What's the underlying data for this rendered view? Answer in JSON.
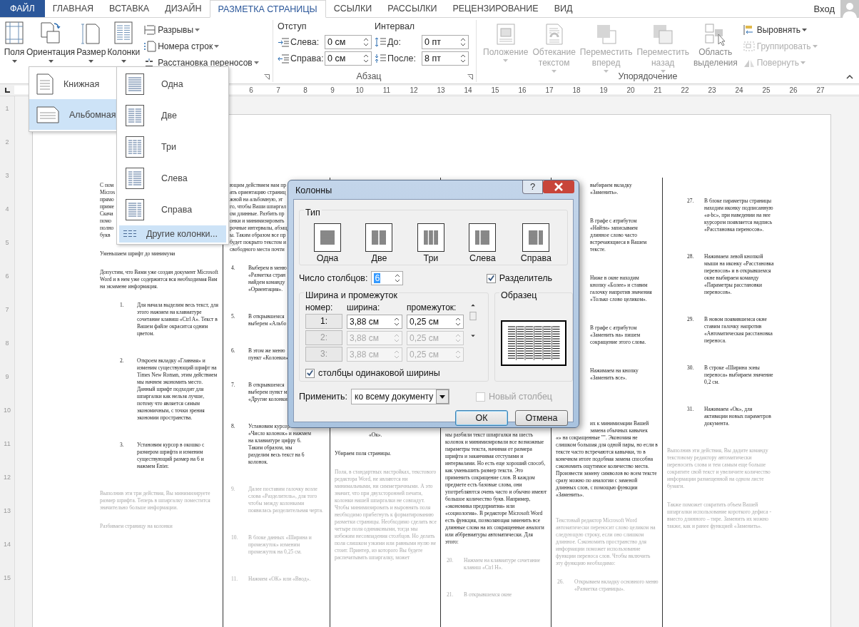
{
  "ribbon": {
    "tabs": [
      {
        "label": "ФАЙЛ",
        "kind": "file",
        "selected": false
      },
      {
        "label": "ГЛАВНАЯ",
        "kind": "tab",
        "selected": false
      },
      {
        "label": "ВСТАВКА",
        "kind": "tab",
        "selected": false
      },
      {
        "label": "ДИЗАЙН",
        "kind": "tab",
        "selected": false
      },
      {
        "label": "РАЗМЕТКА СТРАНИЦЫ",
        "kind": "tab",
        "selected": true
      },
      {
        "label": "ССЫЛКИ",
        "kind": "tab",
        "selected": false
      },
      {
        "label": "РАССЫЛКИ",
        "kind": "tab",
        "selected": false
      },
      {
        "label": "РЕЦЕНЗИРОВАНИЕ",
        "kind": "tab",
        "selected": false
      },
      {
        "label": "ВИД",
        "kind": "tab",
        "selected": false
      }
    ],
    "account": {
      "label": "Вход"
    },
    "page_setup": {
      "large_buttons": [
        {
          "label": "Поля",
          "kind": "margins"
        },
        {
          "label": "Ориентация",
          "kind": "orientation"
        },
        {
          "label": "Размер",
          "kind": "size"
        },
        {
          "label": "Колонки",
          "kind": "columns"
        }
      ],
      "small_buttons": [
        {
          "label": "Разрывы",
          "kind": "breaks"
        },
        {
          "label": "Номера строк",
          "kind": "line_numbers"
        },
        {
          "label": "Расстановка переносов",
          "kind": "hyphenation"
        }
      ]
    },
    "paragraph": {
      "title": "Абзац",
      "indent": {
        "label": "Отступ",
        "fields": [
          {
            "label": "Слева:",
            "kind": "indent_left",
            "value": "0 см"
          },
          {
            "label": "Справа:",
            "kind": "indent_right",
            "value": "0 см"
          }
        ]
      },
      "spacing": {
        "label": "Интервал",
        "fields": [
          {
            "label": "До:",
            "kind": "before",
            "value": "0 пт"
          },
          {
            "label": "После:",
            "kind": "after",
            "value": "8 пт"
          }
        ]
      }
    },
    "arrange": {
      "title": "Упорядочение",
      "large_buttons": [
        {
          "label": "Положение",
          "kind": "position",
          "disabled": true
        },
        {
          "label": "Обтекание текстом",
          "kind": "wrap",
          "disabled": true
        },
        {
          "label": "Переместить вперед",
          "kind": "forward",
          "disabled": true
        },
        {
          "label": "Переместить назад",
          "kind": "backward",
          "disabled": true
        },
        {
          "label": "Область выделения",
          "kind": "selection",
          "disabled": false
        }
      ],
      "small_buttons": [
        {
          "label": "Выровнять",
          "kind": "align",
          "disabled": false
        },
        {
          "label": "Группировать",
          "kind": "group",
          "disabled": true
        },
        {
          "label": "Повернуть",
          "kind": "rotate",
          "disabled": true
        }
      ]
    }
  },
  "ruler": {
    "numbers": [
      "6",
      "7",
      "8",
      "9",
      "10",
      "11",
      "12",
      "13",
      "14",
      "15",
      "16",
      "17",
      "18",
      "19",
      "20",
      "21",
      "22",
      "23",
      "24",
      "25",
      "26",
      "27"
    ],
    "side_numbers": [
      "1",
      "2",
      "3",
      "4",
      "5",
      "6",
      "7",
      "8",
      "9",
      "10",
      "11",
      "12",
      "13",
      "14",
      "15"
    ]
  },
  "document": {
    "columns": [
      {
        "blocks": [
          {
            "kind": "lines",
            "faded": false,
            "lines": [
              "С пом",
              "Micros",
              "прямо",
              "приме",
              "Скача",
              "помо",
              "полно",
              "букв"
            ]
          },
          {
            "kind": "para",
            "faded": false,
            "text": "Уменьшаем шрифт до минимума"
          },
          {
            "kind": "para",
            "faded": false,
            "text": "Допустим, что Вами уже создан документ Microsoft Word и в нем уже содержится вся необходимая Вам на экзамене информация."
          },
          {
            "kind": "item",
            "faded": false,
            "number": "1.",
            "text": "Для начала выделим весь текст, для этого нажмем на клавиатуре сочетание клавиш «Ctrl A». Текст в Вашем файле окрасится одним цветом."
          },
          {
            "kind": "item",
            "faded": false,
            "number": "2.",
            "text": "Откроем вкладку «Главная» и изменим существующий шрифт на Times New Roman, этим действием мы начнем экономить место. Данный шрифт подходит для шпаргалки как нельзя лучше, потому что является самым экономичным, с точки зрения экономии пространства."
          },
          {
            "kind": "item",
            "faded": false,
            "number": "3.",
            "text": "Установим курсор в окошко с размером шрифта и изменим существующий размер на 6 и нажмем Enter."
          },
          {
            "kind": "para",
            "faded": true,
            "text": "Выполнив эти три действия, Вы минимизируете размер шрифта. Теперь в шпаргалку поместится значительно больше информации."
          },
          {
            "kind": "para",
            "faded": true,
            "text": "Разбиваем страницу на колонки"
          }
        ]
      },
      {
        "blocks": [
          {
            "kind": "lines",
            "faded": false,
            "lines": [
              "ющим действием нам пр",
              "ать ориентацию страниц",
              "жной на альбомную, эт",
              "го, чтобы Ваши шпаргал",
              "ом длинные. Разбить пр",
              "онки и минимизировать",
              "рочные интервалы, абзац",
              "ы. Таким образом все пр",
              "будет покрыто текстом и",
              "свободного места почти"
            ]
          },
          {
            "kind": "item_lines",
            "faded": false,
            "number": "4.",
            "lines": [
              "Выберем в меню",
              "«Разметка стран",
              "найдем команду",
              "«Ориентация»."
            ]
          },
          {
            "kind": "item_lines",
            "faded": false,
            "number": "5.",
            "lines": [
              "В открывшемся",
              "выберем «Альбо"
            ]
          },
          {
            "kind": "item_lines",
            "faded": false,
            "number": "6.",
            "lines": [
              "В этом же меню",
              "пункт «Колонки»"
            ]
          },
          {
            "kind": "item_lines",
            "faded": false,
            "number": "7.",
            "lines": [
              "В открывшемся",
              "выберем пункт м",
              "«Другие колонки"
            ]
          },
          {
            "kind": "item_lines",
            "faded": false,
            "number": "8.",
            "lines": [
              "Установим курсор",
              "«Число колонок» и нажмем",
              "на клавиатуре цифру 6.",
              "Таким образом, мы",
              "разделим весь текст на 6",
              "колонок."
            ]
          },
          {
            "kind": "item",
            "faded": true,
            "number": "9.",
            "text": "Далее поставим галочку возле слова «Разделитель», для того чтобы между колонками появилась разделительная черта."
          },
          {
            "kind": "item",
            "faded": true,
            "number": "10.",
            "text": "В блоке данных «Ширина и промежуток» изменим промежуток на 0,25 см."
          },
          {
            "kind": "item",
            "faded": true,
            "number": "11.",
            "text": "Нажмем «ОК» или «Ввод»."
          }
        ]
      },
      {
        "blocks": [
          {
            "kind": "tail",
            "faded": false,
            "text": "«Ок»."
          },
          {
            "kind": "para",
            "faded": false,
            "text": "Убираем поля страницы."
          },
          {
            "kind": "para",
            "faded": true,
            "text": "Поля, в стандартных настройках, текстового редактора Word, не являются ни минимальными, ни симметричными. А это значит, что при двухсторонней печати, колонки нашей шпаргалки не совпадут. Чтобы минимизировать и выровнять поля необходимо прибегнуть к форматированию разметки страницы. Необходимо сделать все четыре поля одинаковыми, тогда мы избежим несовпадения столбцов. Но делать поля слишком узкими или равными нулю не стоит. Принтер, из которого Вы будете распечатывать шпаргалку, может"
          }
        ]
      },
      {
        "blocks": [
          {
            "kind": "para",
            "faded": false,
            "text": "мы разбили текст шпаргалки на шесть колонок и минимизировали все возможные параметры текста, начиная от размера шрифта и заканчивая отступами и интервалами. Но есть еще хороший способ, как уменьшить размер текста. Это применить сокращение слов. В каждом предмете есть базовые слова, они употребляются очень часто и обычно имеют большое количество букв. Например, «экономика предприятия» или «социология». В редакторе Microsoft Word есть функция, позволяющая заменить все длинные слова на их сокращенные аналоги или аббревиатуры автоматически. Для этого:"
          },
          {
            "kind": "item",
            "faded": true,
            "number": "20.",
            "text": "Нажмем на клавиатуре сочетание клавиш «Ctrl H»."
          },
          {
            "kind": "item",
            "faded": true,
            "number": "21.",
            "text": "В открывшемся окне"
          }
        ]
      },
      {
        "blocks": [
          {
            "kind": "lines",
            "faded": false,
            "lines": [
              "выбираем вкладку",
              "«Заменить»."
            ]
          },
          {
            "kind": "lines",
            "faded": false,
            "lines": [
              "В графе с атрибутом",
              "«Найти» записываем",
              "длинное слово часто",
              "встречающиеся в Вашем",
              "тексте."
            ]
          },
          {
            "kind": "lines",
            "faded": false,
            "lines": [
              "Ниже в окне находим",
              "кнопку «Более» и ставим",
              "галочку напротив значения",
              "«Только слово целиком»."
            ]
          },
          {
            "kind": "lines",
            "faded": false,
            "lines": [
              "В графе с атрибутом",
              "«Заменить на» пишем",
              "сокращение этого слова."
            ]
          },
          {
            "kind": "lines",
            "faded": false,
            "lines": [
              "Нажимаем на кнопку",
              "«Заменить все»."
            ]
          },
          {
            "kind": "lines",
            "faded": false,
            "lines": [
              "их к минимизации Вашей",
              "замена обычных кавычек"
            ]
          },
          {
            "kind": "para",
            "faded": false,
            "text": "«» на сокращенные \"\". Экономия не слишком большая для одной пары, но если в тексте часто встречаются кавычки, то в конечном итоге подобная замена способна сэкономить ощутимое количество места. Произвести замену символов во всем тексте сразу можно по аналогии с заменой длинных слов, с помощью функции «Заменить»."
          },
          {
            "kind": "para",
            "faded": true,
            "text": "Текстовый редактор Microsoft Word автоматически переносит слово целиком на следующую строку, если оно слишком длинное. Сэкономить пространство для информации поможет использование функции переноса слов. Чтобы включить эту функцию необходимо:"
          },
          {
            "kind": "item",
            "faded": true,
            "number": "26.",
            "text": "Открываем вкладку основного меню «Разметка страницы»."
          }
        ]
      },
      {
        "blocks": [
          {
            "kind": "item",
            "faded": false,
            "number": "27.",
            "text": "В блоке параметры страницы находим иконку подписанную «a-bc», при наведении на нее курсором появляется надпись «Расстановка переносов»."
          },
          {
            "kind": "item",
            "faded": false,
            "number": "28.",
            "text": "Нажимаем левой кнопкой мыши на иконку «Расстановка переносов» и в открывшемся окне выбираем команду «Параметры расстановки переносов»."
          },
          {
            "kind": "item",
            "faded": false,
            "number": "29.",
            "text": "В новом появившемся окне ставим галочку напротив «Автоматическая расстановка переноса."
          },
          {
            "kind": "item",
            "faded": false,
            "number": "30.",
            "text": "В строке «Ширина зоны переноса» выбираем значение 0,2 см."
          },
          {
            "kind": "item",
            "faded": false,
            "number": "31.",
            "text": "Нажимаем «Ок», для активации новых параметров документа."
          },
          {
            "kind": "para",
            "faded": true,
            "text": "Выполнив эти действия, Вы дадите команду текстовому редактору автоматически переносить слова и тем самым еще больше сократите свой текст и увеличите количество информации размещенной на одном листе бумаги."
          },
          {
            "kind": "para",
            "faded": true,
            "text": "Также поможет сократить объем Вашей шпаргалки использование короткого дефиса - вместо длинного – тире. Заменить их можно также, как и ранее функцией «Заменить»."
          }
        ]
      }
    ]
  },
  "orientation_menu": {
    "items": [
      {
        "label": "Книжная",
        "kind": "portrait",
        "selected": false
      },
      {
        "label": "Альбомная",
        "kind": "landscape",
        "selected": true
      }
    ]
  },
  "columns_menu": {
    "items": [
      {
        "label": "Одна",
        "kind": "one",
        "selected": false
      },
      {
        "label": "Две",
        "kind": "two",
        "selected": false
      },
      {
        "label": "Три",
        "kind": "three",
        "selected": false
      },
      {
        "label": "Слева",
        "kind": "left",
        "selected": false
      },
      {
        "label": "Справа",
        "kind": "right",
        "selected": false
      },
      {
        "label": "Другие колонки...",
        "kind": "more",
        "selected": true
      }
    ]
  },
  "dialog": {
    "title": "Колонны",
    "help_label": "?",
    "type_group": {
      "title": "Тип",
      "presets": [
        {
          "label": "Одна",
          "kind": "one",
          "selected": false
        },
        {
          "label": "Две",
          "kind": "two",
          "selected": false
        },
        {
          "label": "Три",
          "kind": "three",
          "selected": false
        },
        {
          "label": "Слева",
          "kind": "left",
          "selected": false
        },
        {
          "label": "Справа",
          "kind": "right",
          "selected": false
        }
      ]
    },
    "count": {
      "label": "Число столбцов:",
      "value": "6"
    },
    "separator": {
      "label": "Разделитель",
      "checked": true
    },
    "width_group": {
      "title": "Ширина и промежуток",
      "headers": [
        "номер:",
        "ширина:",
        "промежуток:"
      ],
      "rows": [
        {
          "number": "1:",
          "width": "3,88 см",
          "spacing": "0,25 см",
          "disabled": false
        },
        {
          "number": "2:",
          "width": "3,88 см",
          "spacing": "0,25 см",
          "disabled": true
        },
        {
          "number": "3:",
          "width": "3,88 см",
          "spacing": "0,25 см",
          "disabled": true
        }
      ]
    },
    "equal_width": {
      "label": "столбцы одинаковой ширины",
      "checked": true
    },
    "preview": {
      "title": "Образец"
    },
    "apply": {
      "label": "Применить:",
      "value": "ко всему документу"
    },
    "new_column": {
      "label": "Новый столбец",
      "checked": false,
      "disabled": true
    },
    "buttons": [
      {
        "label": "ОК",
        "kind": "default"
      },
      {
        "label": "Отмена",
        "kind": "normal"
      }
    ]
  }
}
